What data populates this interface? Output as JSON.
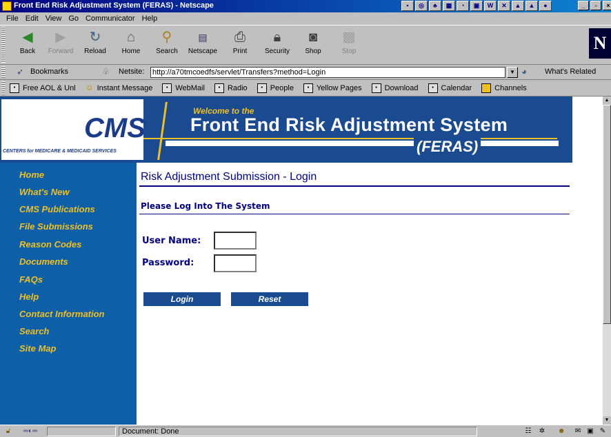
{
  "window": {
    "title": "Front End Risk Adjustment System (FERAS) - Netscape"
  },
  "menu": [
    "File",
    "Edit",
    "View",
    "Go",
    "Communicator",
    "Help"
  ],
  "toolbar": {
    "back": "Back",
    "forward": "Forward",
    "reload": "Reload",
    "home": "Home",
    "search": "Search",
    "netscape": "Netscape",
    "print": "Print",
    "security": "Security",
    "shop": "Shop",
    "stop": "Stop",
    "logo": "N"
  },
  "location": {
    "bookmarks": "Bookmarks",
    "netsite_label": "Netsite:",
    "url": "http://a70tmcoedfs/servlet/Transfers?method=Login",
    "whats_related": "What's Related"
  },
  "personal_bar": [
    "Free AOL & Unl",
    "Instant Message",
    "WebMail",
    "Radio",
    "People",
    "Yellow Pages",
    "Download",
    "Calendar",
    "Channels"
  ],
  "banner": {
    "logo_text": "CMS",
    "logo_sub": "CENTERS for MEDICARE & MEDICAID SERVICES",
    "welcome": "Welcome to the",
    "system_name": "Front End Risk Adjustment System",
    "acronym": "(FERAS)"
  },
  "nav": [
    "Home",
    "What's New",
    "CMS Publications",
    "File Submissions",
    "Reason Codes",
    "Documents",
    "FAQs",
    "Help",
    "Contact Information",
    "Search",
    "Site Map"
  ],
  "main": {
    "heading": "Risk Adjustment Submission - Login",
    "subheading": "Please Log Into The System",
    "username_label": "User Name:",
    "password_label": "Password:",
    "username_value": "",
    "password_value": "",
    "login_button": "Login",
    "reset_button": "Reset"
  },
  "status": {
    "text": "Document: Done"
  },
  "colors": {
    "banner_blue": "#1a4a8f",
    "nav_blue": "#0d5fa8",
    "gold": "#f0c020",
    "heading_navy": "#000080"
  }
}
